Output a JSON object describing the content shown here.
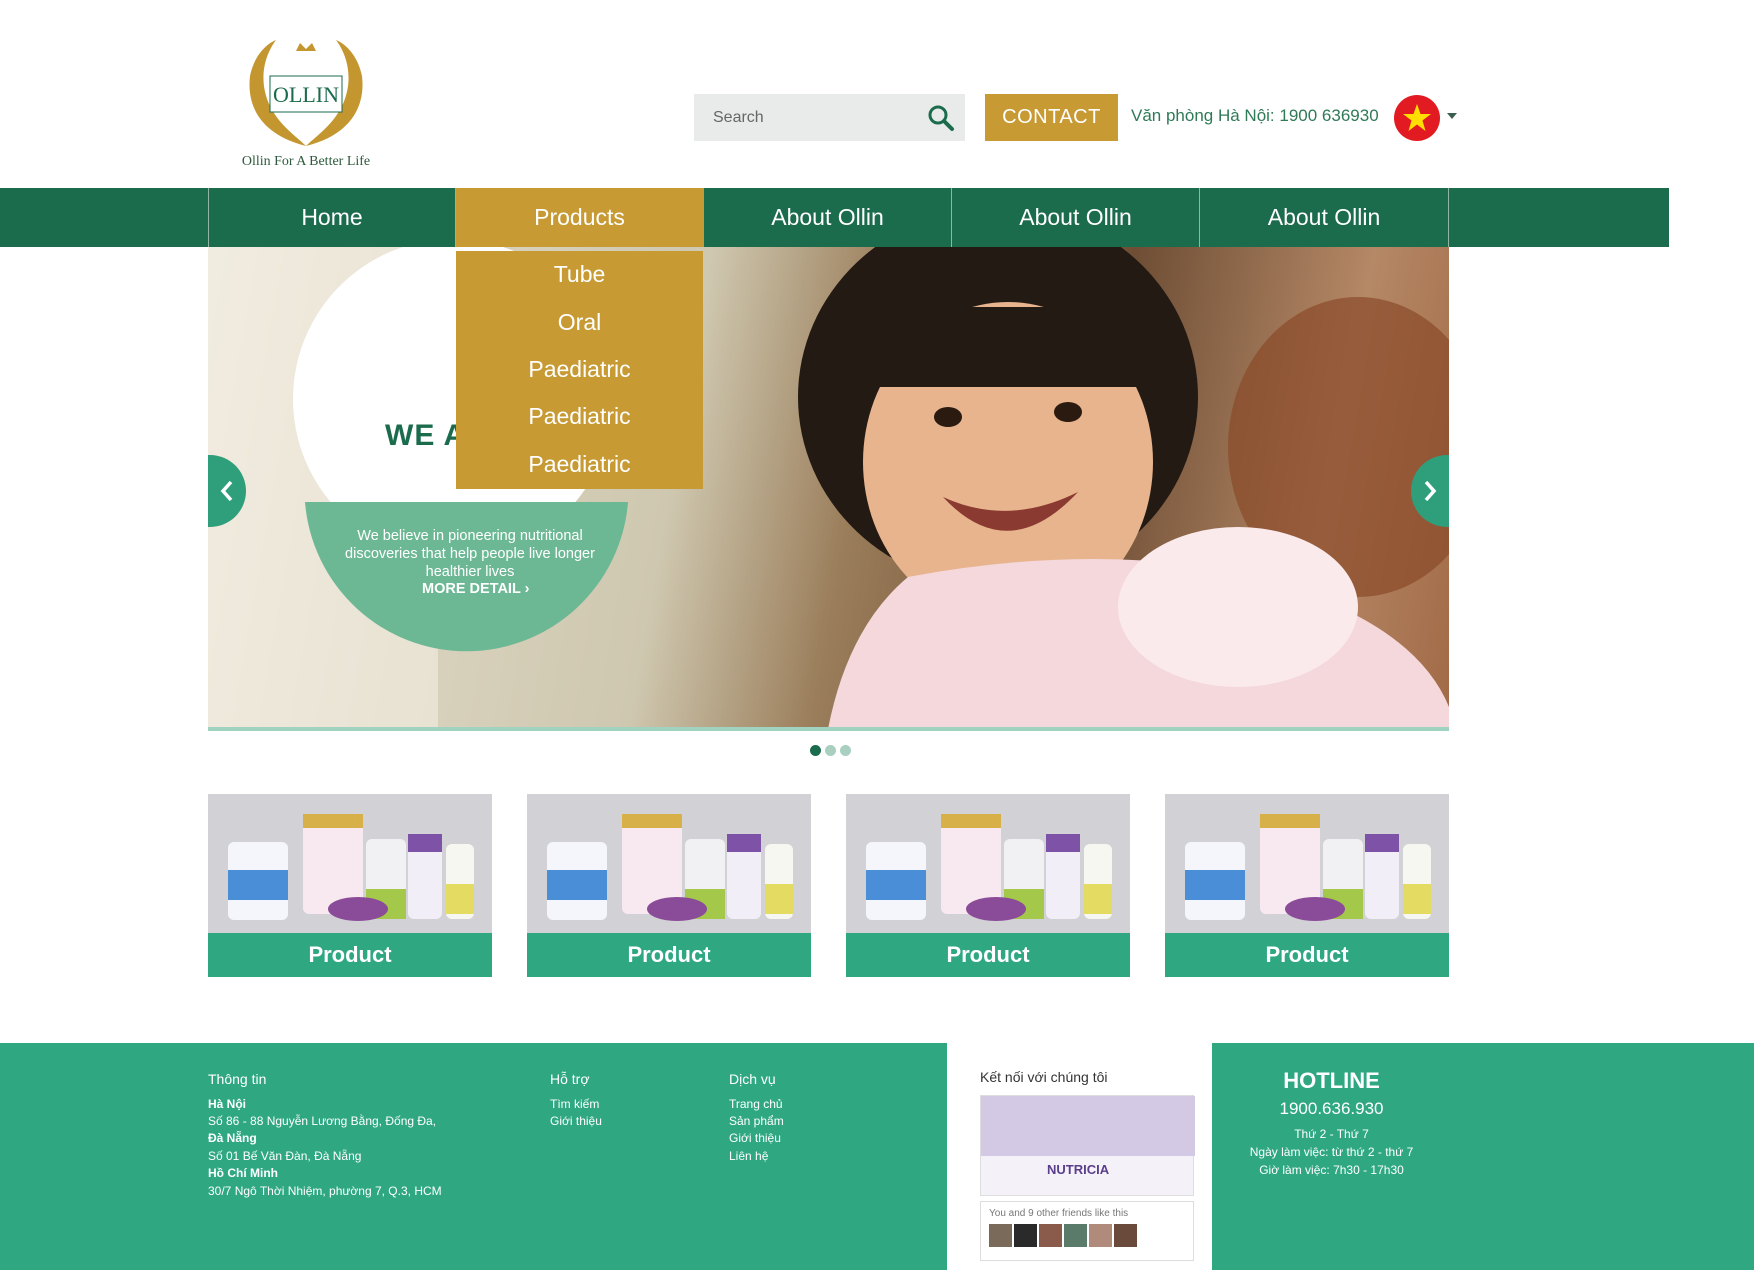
{
  "header": {
    "logo_text": "OLLIN",
    "tagline": "Ollin For A Better Life",
    "search": {
      "placeholder": "Search"
    },
    "contact_label": "CONTACT",
    "office": "Văn phòng Hà Nội: 1900 636930",
    "language_flag": "vietnam-flag-icon"
  },
  "nav": {
    "items": [
      {
        "label": "Home"
      },
      {
        "label": "Products"
      },
      {
        "label": "About Ollin"
      },
      {
        "label": "About Ollin"
      },
      {
        "label": "About Ollin"
      }
    ],
    "active": "Products",
    "dropdown": [
      "Tube",
      "Oral",
      "Paediatric",
      "Paediatric",
      "Paediatric"
    ]
  },
  "hero": {
    "heading": "WE A",
    "text": "We believe in pioneering nutritional discoveries that help people live longer healthier lives",
    "more_label": "MORE DETAIL",
    "slide_count": 3,
    "active_slide": 1
  },
  "products": [
    {
      "label": "Product"
    },
    {
      "label": "Product"
    },
    {
      "label": "Product"
    },
    {
      "label": "Product"
    }
  ],
  "footer": {
    "info": {
      "title": "Thông tin",
      "lines": [
        {
          "text": "Hà Nội",
          "bold": true
        },
        {
          "text": "Số 86 - 88 Nguyễn Lương Bằng, Đống Đa,",
          "bold": false
        },
        {
          "text": "Đà Nẵng",
          "bold": true
        },
        {
          "text": "Số 01 Bế Văn Đàn, Đà Nẵng",
          "bold": false
        },
        {
          "text": "Hồ Chí Minh",
          "bold": true
        },
        {
          "text": "30/7 Ngô Thời Nhiệm, phường 7, Q.3, HCM",
          "bold": false
        }
      ]
    },
    "support": {
      "title": "Hỗ trợ",
      "links": [
        "Tìm kiếm",
        "Giới thiệu"
      ]
    },
    "services": {
      "title": "Dịch vụ",
      "links": [
        "Trang chủ",
        "Sản phẩm",
        "Giới thiệu",
        "Liên hệ"
      ]
    },
    "social": {
      "title": "Kết nối với chúng tôi",
      "brand": "NUTRICIA",
      "friends_text": "You and 9 other friends like this"
    },
    "hotline": {
      "title": "HOTLINE",
      "number": "1900.636.930",
      "lines": [
        "Thứ 2 - Thứ 7",
        "Ngày làm việc: từ thứ 2 - thứ 7",
        "Giờ làm việc: 7h30 - 17h30"
      ]
    }
  },
  "colors": {
    "green_dark": "#1b6b4d",
    "green_footer": "#2fa882",
    "gold": "#c79a34",
    "flag_red": "#e21b23"
  }
}
